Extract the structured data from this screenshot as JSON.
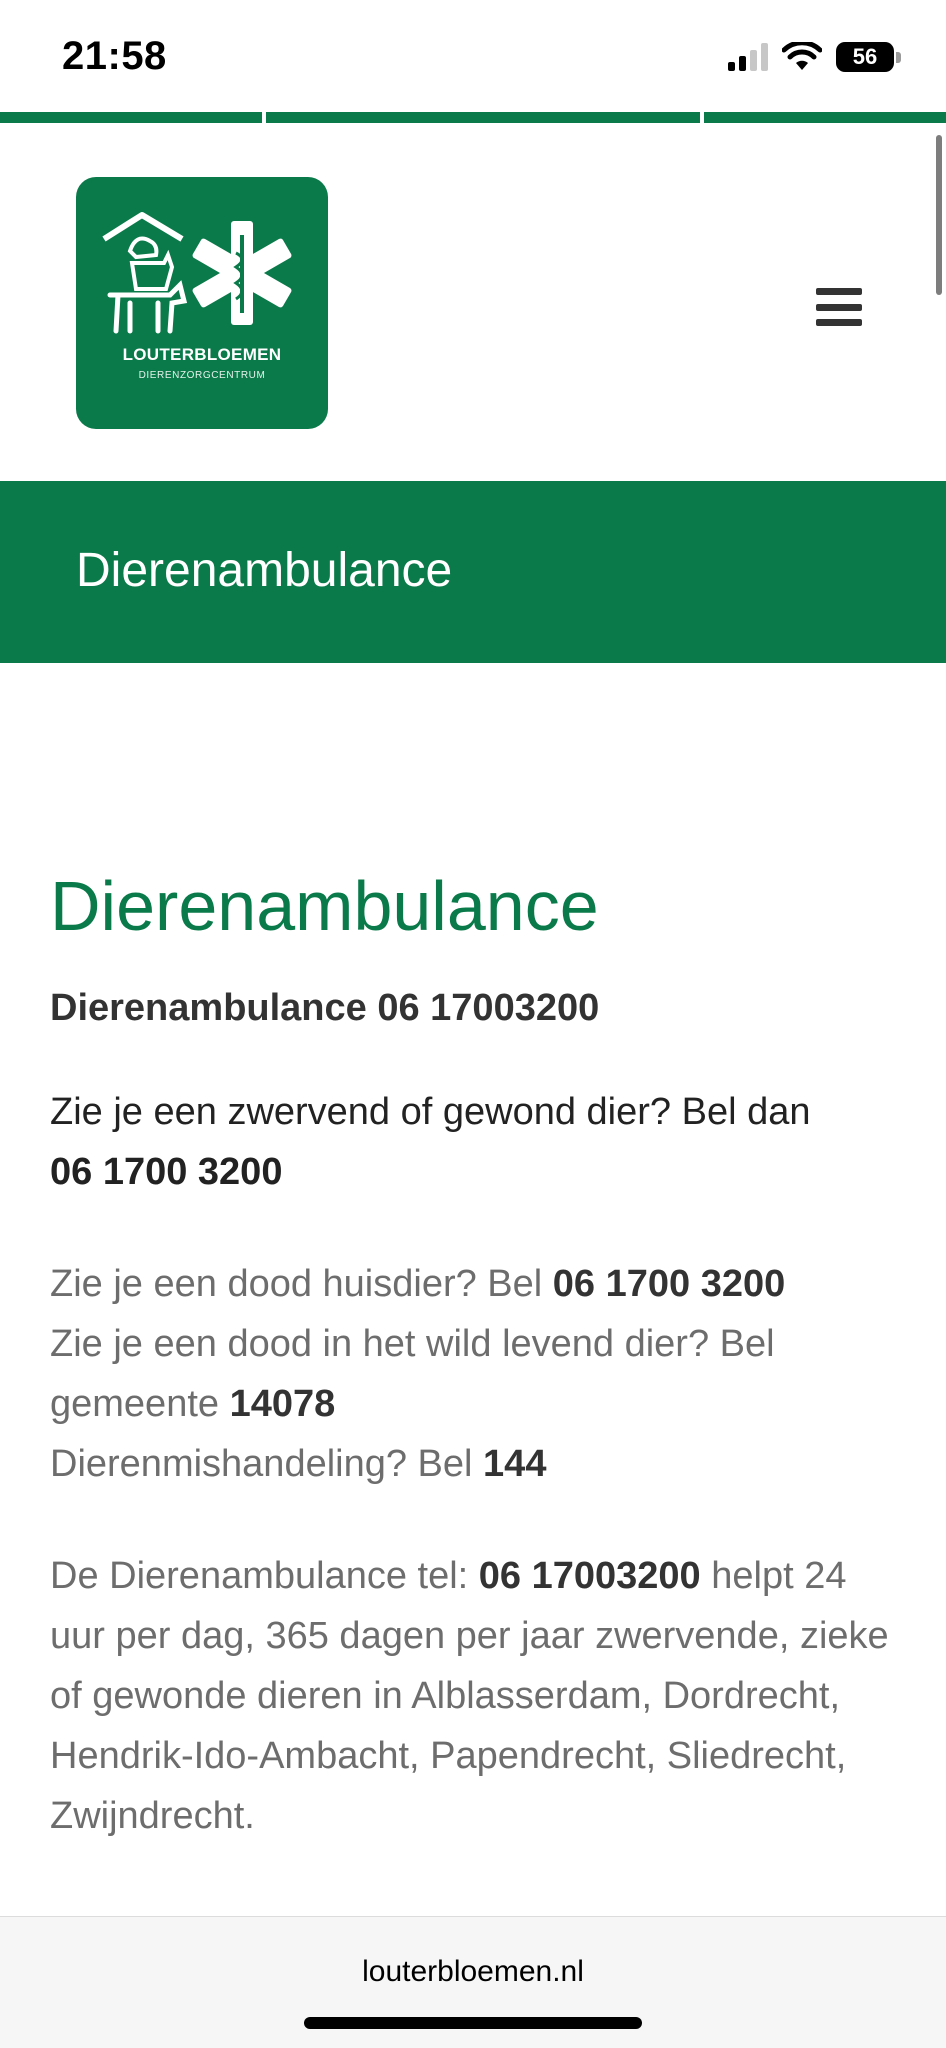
{
  "status_bar": {
    "time": "21:58",
    "battery": "56",
    "icons": [
      "signal-icon",
      "wifi-icon",
      "battery-icon"
    ]
  },
  "header": {
    "logo": {
      "title": "LOUTERBLOEMEN",
      "subtitle": "DIERENZORGCENTRUM"
    },
    "menu_icon": "hamburger-icon"
  },
  "banner": {
    "title": "Dierenambulance"
  },
  "main": {
    "heading": "Dierenambulance",
    "emergency_line": "Dierenambulance 06 17003200",
    "stray_text": "Zie je een zwervend of gewond dier? Bel dan",
    "stray_number": "06 1700 3200",
    "dead_pet_text": "Zie je een dood huisdier? Bel",
    "dead_pet_number": "06 1700 3200",
    "dead_wild_text": "Zie je een dood in het wild levend dier? Bel gemeente",
    "dead_wild_number": "14078",
    "abuse_text": "Dierenmishandeling? Bel",
    "abuse_number": "144",
    "service_intro": "De Dierenambulance tel:",
    "service_number": "06 17003200",
    "service_text": "helpt 24 uur per dag, 365 dagen per jaar zwervende, zieke of gewonde dieren in Alblasserdam, Dordrecht, Hendrik-Ido-Ambacht, Papendrecht, Sliedrecht, Zwijndrecht."
  },
  "browser": {
    "url": "louterbloemen.nl"
  },
  "colors": {
    "brand_green": "#0a7a4a",
    "text_dark": "#333333",
    "text_muted": "#6d6d6d"
  }
}
